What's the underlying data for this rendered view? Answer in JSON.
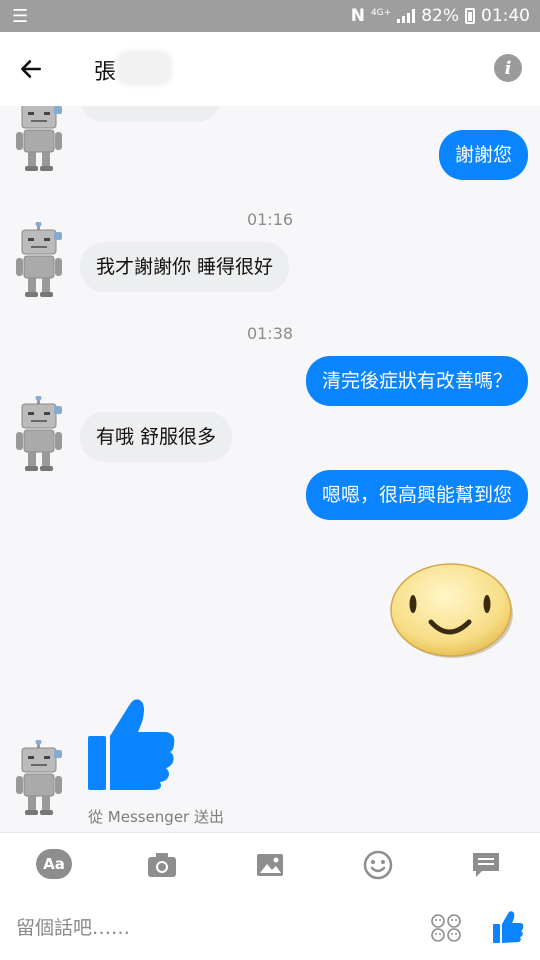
{
  "status_bar": {
    "menu_icon": "menu-icon",
    "network": "4G+",
    "battery_percent": "82%",
    "time": "01:40",
    "colors": {
      "background": "#9e9e9e",
      "text": "#ffffff"
    }
  },
  "header": {
    "back_icon": "back-arrow-icon",
    "contact_name": "張",
    "info_icon": "info-icon"
  },
  "conversation": {
    "timestamps": [
      "01:16",
      "01:38"
    ],
    "messages": [
      {
        "from": "them",
        "text": ""
      },
      {
        "from": "me",
        "text": "謝謝您"
      },
      {
        "from": "them",
        "text": "我才謝謝你 睡得很好"
      },
      {
        "from": "me",
        "text": "清完後症狀有改善嗎？"
      },
      {
        "from": "them",
        "text": "有哦 舒服很多"
      },
      {
        "from": "me",
        "text": "嗯嗯，很高興能幫到您"
      },
      {
        "from": "me",
        "sticker": "smiley-face"
      },
      {
        "from": "them",
        "sticker": "thumbs-up"
      }
    ],
    "sent_via": "從 Messenger 送出",
    "colors": {
      "outgoing": "#0a84ff",
      "incoming": "#eceef0",
      "timestamp": "#8d8d8d"
    }
  },
  "toolbar": {
    "text_format_label": "Aa",
    "icons": [
      "text-format-icon",
      "camera-icon",
      "image-icon",
      "emoji-icon",
      "chat-icon"
    ]
  },
  "composer": {
    "placeholder": "留個話吧……",
    "value": "",
    "emoji_picker_icon": "emoji-grid-icon",
    "like_icon": "like-icon"
  }
}
